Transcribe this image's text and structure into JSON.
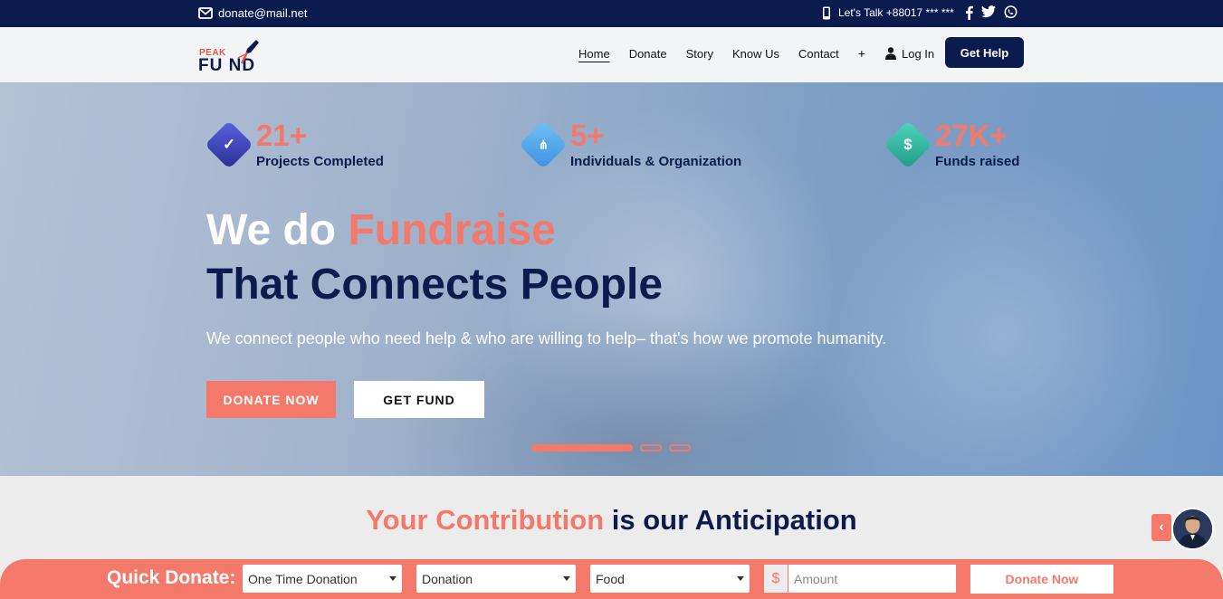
{
  "topbar": {
    "email": "donate@mail.net",
    "phone": "Let's Talk +88017 *** ***",
    "social": [
      "facebook-icon",
      "twitter-icon",
      "whatsapp-icon"
    ]
  },
  "header": {
    "logo_top": "PEAK",
    "logo_bottom": "FU ND",
    "nav": [
      "Home",
      "Donate",
      "Story",
      "Know Us",
      "Contact"
    ],
    "more": "+",
    "login": "Log In",
    "cta": "Get Help"
  },
  "hero": {
    "stats": [
      {
        "value": "21+",
        "label": "Projects Completed",
        "icon": "check-icon",
        "color": "#3b3fb8"
      },
      {
        "value": "5+",
        "label": "Individuals & Organization",
        "icon": "network-icon",
        "color": "#3d9ee8"
      },
      {
        "value": "27K+",
        "label": "Funds raised",
        "icon": "dollar-icon",
        "color": "#2bb5a0"
      }
    ],
    "title_prefix": "We do ",
    "title_highlight": "Fundraise",
    "title_line2": "That Connects People",
    "subtitle": "We connect people who need help & who are willing to help– that's how we promote humanity.",
    "donate_btn": "DONATE NOW",
    "fund_btn": "GET FUND",
    "slide_active": 1,
    "slide_count": 3
  },
  "contribution": {
    "title_highlight": "Your Contribution",
    "title_rest": " is our Anticipation"
  },
  "quick_donate": {
    "title": "Quick Donate:",
    "frequency": "One Time Donation",
    "type": "Donation",
    "category": "Food",
    "currency": "$",
    "amount_placeholder": "Amount",
    "button": "Donate Now"
  },
  "colors": {
    "navy": "#0c1b4d",
    "accent": "#f4796b"
  }
}
